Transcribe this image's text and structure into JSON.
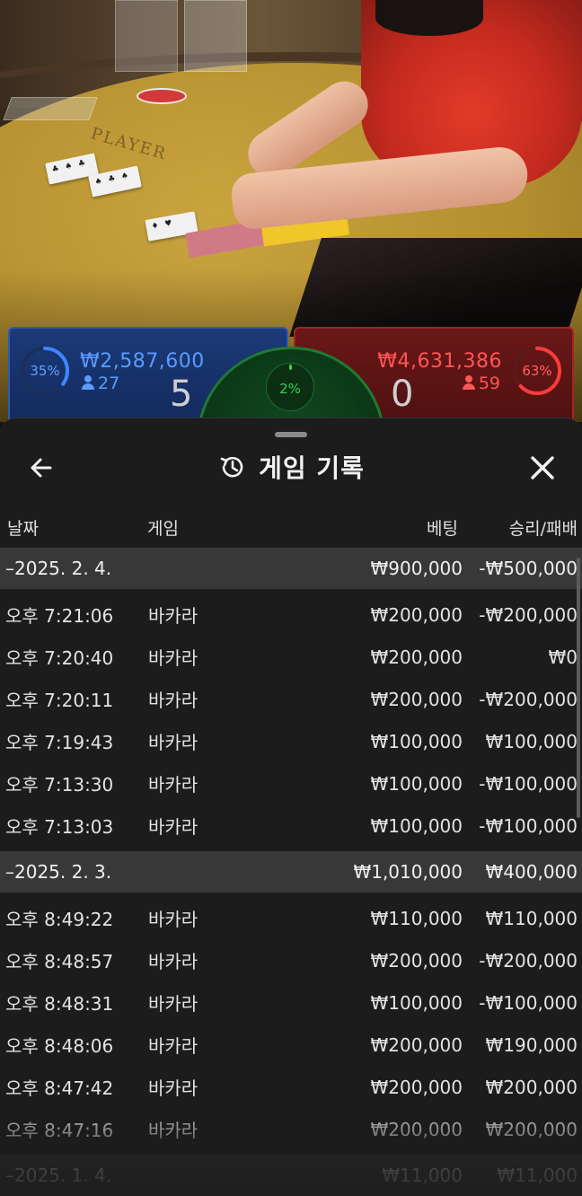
{
  "colors": {
    "player": "#2c5bb8",
    "banker": "#a22424",
    "tie": "#34d058",
    "sheet_bg": "#1c1c1c",
    "group_bg": "#383838"
  },
  "table_scene": {
    "felt_text": "PLAYER"
  },
  "bet_panels": {
    "player": {
      "percent": "35%",
      "percent_value": 35,
      "amount": "₩2,587,600",
      "bettors": "27",
      "score": "5"
    },
    "banker": {
      "percent": "63%",
      "percent_value": 63,
      "amount": "₩4,631,386",
      "bettors": "59",
      "score": "0"
    },
    "tie": {
      "percent": "2%",
      "percent_value": 2
    }
  },
  "sheet": {
    "title": "게임 기록",
    "title_icon": "history-icon",
    "back_icon": "arrow-left-icon",
    "close_icon": "close-icon"
  },
  "columns": {
    "date": "날짜",
    "game": "게임",
    "bet": "베팅",
    "result": "승리/패배"
  },
  "groups": [
    {
      "date": "–2025. 2. 4.",
      "bet": "₩900,000",
      "result": "-₩500,000",
      "rows": [
        {
          "time": "오후 7:21:06",
          "game": "바카라",
          "bet": "₩200,000",
          "result": "-₩200,000"
        },
        {
          "time": "오후 7:20:40",
          "game": "바카라",
          "bet": "₩200,000",
          "result": "₩0"
        },
        {
          "time": "오후 7:20:11",
          "game": "바카라",
          "bet": "₩200,000",
          "result": "-₩200,000"
        },
        {
          "time": "오후 7:19:43",
          "game": "바카라",
          "bet": "₩100,000",
          "result": "₩100,000"
        },
        {
          "time": "오후 7:13:30",
          "game": "바카라",
          "bet": "₩100,000",
          "result": "-₩100,000"
        },
        {
          "time": "오후 7:13:03",
          "game": "바카라",
          "bet": "₩100,000",
          "result": "-₩100,000"
        }
      ]
    },
    {
      "date": "–2025. 2. 3.",
      "bet": "₩1,010,000",
      "result": "₩400,000",
      "rows": [
        {
          "time": "오후 8:49:22",
          "game": "바카라",
          "bet": "₩110,000",
          "result": "₩110,000"
        },
        {
          "time": "오후 8:48:57",
          "game": "바카라",
          "bet": "₩200,000",
          "result": "-₩200,000"
        },
        {
          "time": "오후 8:48:31",
          "game": "바카라",
          "bet": "₩100,000",
          "result": "-₩100,000"
        },
        {
          "time": "오후 8:48:06",
          "game": "바카라",
          "bet": "₩200,000",
          "result": "₩190,000"
        },
        {
          "time": "오후 8:47:42",
          "game": "바카라",
          "bet": "₩200,000",
          "result": "₩200,000"
        },
        {
          "time": "오후 8:47:16",
          "game": "바카라",
          "bet": "₩200,000",
          "result": "₩200,000"
        }
      ]
    },
    {
      "date": "–2025. 1. 4.",
      "bet": "₩11,000",
      "result": "₩11,000",
      "rows": []
    }
  ]
}
